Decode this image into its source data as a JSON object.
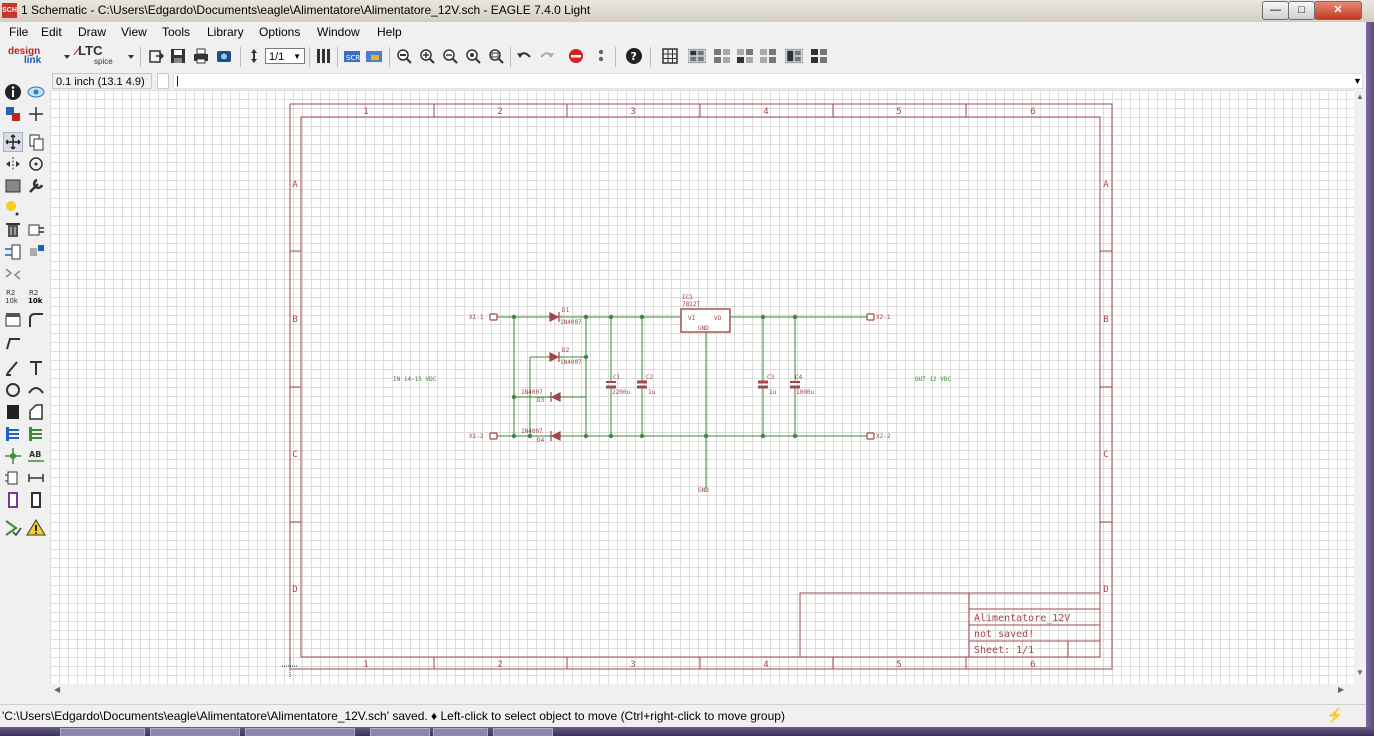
{
  "window": {
    "title": "1 Schematic - C:\\Users\\Edgardo\\Documents\\eagle\\Alimentatore\\Alimentatore_12V.sch - EAGLE 7.4.0 Light",
    "app_icon": "SCH",
    "minimize_icon": "minimize-icon",
    "maximize_icon": "maximize-icon",
    "close_icon": "close-icon"
  },
  "menu": [
    "File",
    "Edit",
    "Draw",
    "View",
    "Tools",
    "Library",
    "Options",
    "Window",
    "Help"
  ],
  "toolbar": {
    "designlink_line1": "design",
    "designlink_line2": "link",
    "ltc_label": "LTC",
    "ltc_sub": "spice",
    "sheet_select": "1/1"
  },
  "coord": {
    "readout": "0.1 inch (13.1 4.9)",
    "command": ""
  },
  "frame": {
    "columns": [
      "1",
      "2",
      "3",
      "4",
      "5",
      "6"
    ],
    "rows": [
      "A",
      "B",
      "C",
      "D"
    ]
  },
  "title_block": {
    "name": "Alimentatore_12V",
    "status": "not saved!",
    "sheet": "Sheet: 1/1"
  },
  "parts": {
    "x1_in": "X1-1",
    "x1_in2": "X1-2",
    "x2_out": "X2-1",
    "x2_out2": "X2-2",
    "d1": "D1",
    "d1_val": "1N4007",
    "d2": "D2",
    "d2_val": "1N4007",
    "d3": "D3",
    "d3_val": "1N4007",
    "d4": "D4",
    "d4_val": "1N4007",
    "c1": "C1",
    "c1_val": "2200u",
    "c2": "C2",
    "c2_val": "1u",
    "c3": "C3",
    "c3_val": "1u",
    "c4": "C4",
    "c4_val": "1000u",
    "ic1": "IC1",
    "ic1_val": "7812T",
    "ic1_vi": "VI",
    "ic1_vo": "VO",
    "ic1_gnd": "GND",
    "gnd_label": "GND",
    "in_label": "IN 14-15 VDC",
    "out_label": "OUT 12 VDC"
  },
  "status": {
    "text": "'C:\\Users\\Edgardo\\Documents\\eagle\\Alimentatore\\Alimentatore_12V.sch' saved.  ♦ Left-click to select object to move (Ctrl+right-click to move group)"
  },
  "colors": {
    "frame": "#a04848",
    "wire": "#3c8a3c",
    "grid": "#dcdcdc",
    "symbol": "#a04848"
  }
}
